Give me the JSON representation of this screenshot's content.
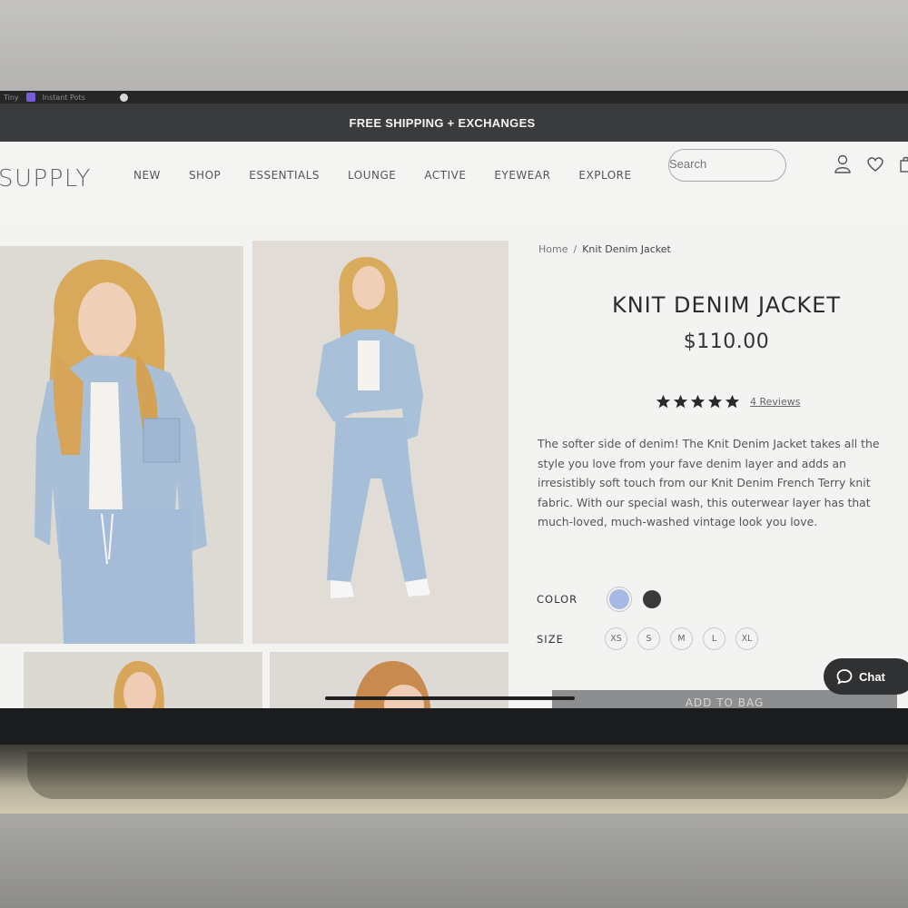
{
  "browser": {
    "tab_texts": [
      "Tiny",
      "Instant Pots"
    ]
  },
  "promo_bar": {
    "text": "FREE SHIPPING + EXCHANGES"
  },
  "header": {
    "logo": "SUPPLY",
    "nav": [
      "NEW",
      "SHOP",
      "ESSENTIALS",
      "LOUNGE",
      "ACTIVE",
      "EYEWEAR",
      "EXPLORE"
    ],
    "search_placeholder": "Search",
    "icons": [
      "account-icon",
      "wishlist-heart-icon",
      "shopping-bag-icon"
    ]
  },
  "breadcrumb": {
    "home": "Home",
    "separator": "/",
    "current": "Knit Denim Jacket"
  },
  "product": {
    "title": "KNIT DENIM JACKET",
    "price": "$110.00",
    "rating": 5,
    "reviews_label": "4 Reviews",
    "description": "The softer side of denim! The Knit Denim Jacket takes all the style you love from your fave denim layer and adds an irresistibly soft touch from our Knit Denim French Terry knit fabric. With our special wash, this outerwear layer has that much-loved, much-washed vintage look you love.",
    "color_label": "COLOR",
    "colors": [
      {
        "name": "light-blue",
        "hex": "#a7b8e4",
        "selected": true
      },
      {
        "name": "black",
        "hex": "#3a3a3b",
        "selected": false
      }
    ],
    "size_label": "SIZE",
    "sizes": [
      "XS",
      "S",
      "M",
      "L",
      "XL"
    ],
    "add_to_bag": "ADD TO BAG"
  },
  "chat": {
    "label": "Chat"
  },
  "colors": {
    "promo_bg": "#3a3b3d",
    "page_bg": "#f3f3f2",
    "text_dark": "#2b2b2b"
  }
}
